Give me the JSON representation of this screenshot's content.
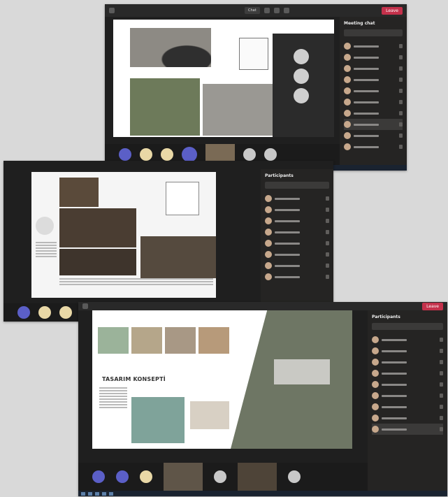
{
  "screens": [
    {
      "panel": {
        "title": "Meeting chat",
        "search": "Search",
        "people": [
          "Participant 1",
          "Participant 2",
          "Participant 3",
          "Participant 4",
          "Participant 5",
          "Participant 6",
          "Participant 7",
          "Participant 8",
          "Participant 9",
          "Participant 10"
        ]
      },
      "toolbar": {
        "leave": "Leave",
        "chat": "Chat"
      }
    },
    {
      "panel": {
        "title": "Participants",
        "search": "Search",
        "people": [
          "Participant 1",
          "Participant 2",
          "Participant 3",
          "Participant 4",
          "Participant 5",
          "Participant 6",
          "Participant 7",
          "Participant 8"
        ]
      }
    },
    {
      "panel": {
        "title": "Participants",
        "search": "Search",
        "people": [
          "Participant 1",
          "Participant 2",
          "Participant 3",
          "Participant 4",
          "Participant 5",
          "Participant 6",
          "Participant 7",
          "Participant 8",
          "Participant 9"
        ]
      },
      "slide_title": "TASARIM KONSEPTİ",
      "toolbar": {
        "leave": "Leave"
      }
    }
  ],
  "colors": {
    "accent": "#5b5fc7",
    "leave": "#c4314b",
    "panel": "#252423"
  }
}
